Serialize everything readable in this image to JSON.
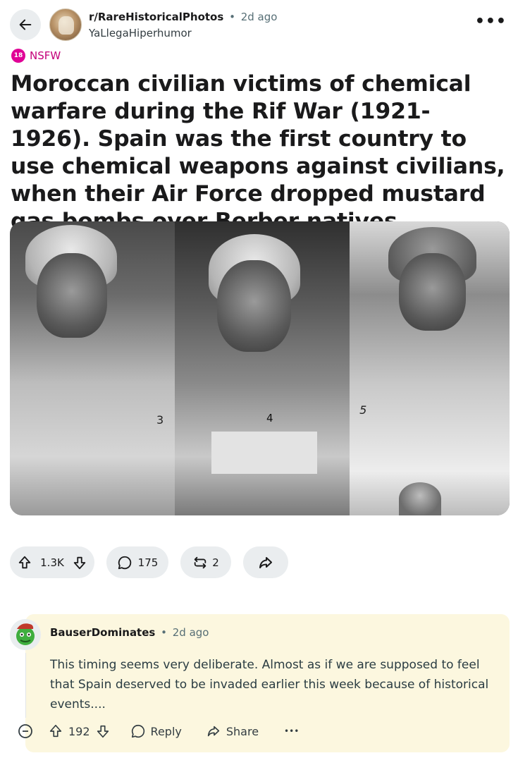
{
  "header": {
    "subreddit": "r/RareHistoricalPhotos",
    "dot": "•",
    "time": "2d ago",
    "author": "YaLlegaHiperhumor",
    "more": "•••"
  },
  "nsfw": {
    "badge": "18",
    "label": "NSFW"
  },
  "post": {
    "title": "Moroccan civilian victims of chemical warfare during the Rif War (1921-1926). Spain was the first country to use chemical weapons against civilians, when their Air Force dropped mustard gas bombs over Berber natives",
    "image_labels": [
      "3",
      "4",
      "5"
    ]
  },
  "actions": {
    "upvotes": "1.3K",
    "comments": "175",
    "crossposts": "2"
  },
  "comment": {
    "author": "BauserDominates",
    "dot": "•",
    "time": "2d ago",
    "body": "This timing seems very deliberate. Almost as if we are supposed to feel that Spain deserved to be invaded earlier this week because of historical events....",
    "score": "192",
    "reply_label": "Reply",
    "share_label": "Share",
    "more": "•••"
  },
  "colors": {
    "nsfw": "#e00096",
    "pill_bg": "#eaedef",
    "comment_highlight": "#fcf7df"
  }
}
